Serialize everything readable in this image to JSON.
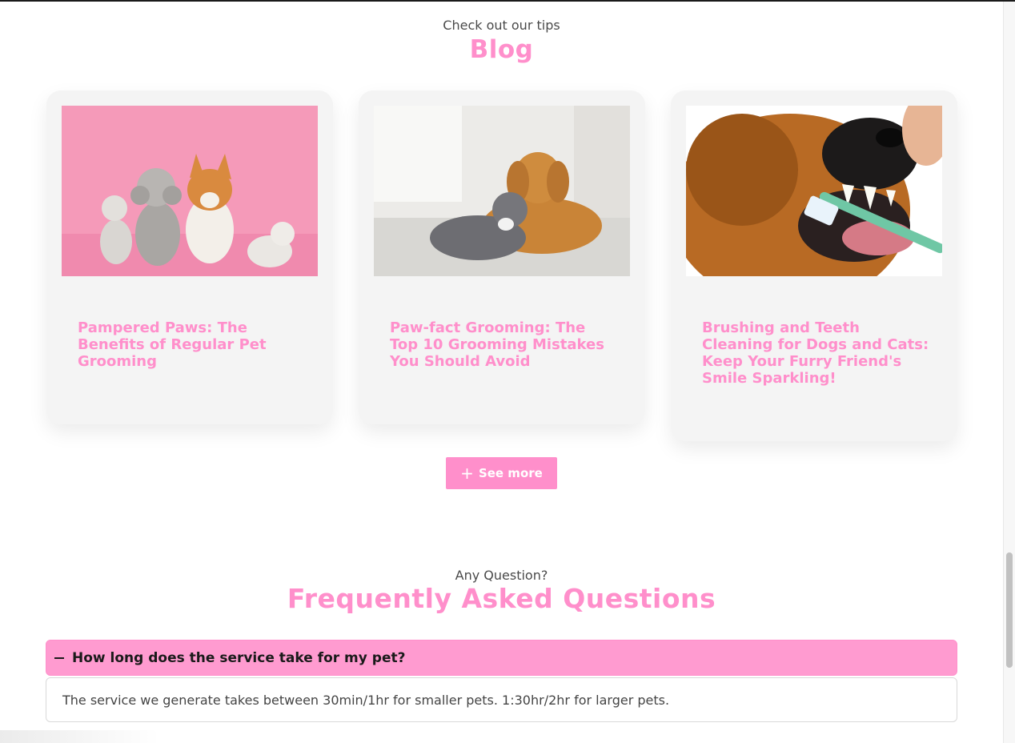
{
  "blog": {
    "eyebrow": "Check out our tips",
    "title": "Blog",
    "posts": [
      {
        "title": "Pampered Paws: The Benefits of Regular Pet Grooming"
      },
      {
        "title": "Paw-fact Grooming: The Top 10 Grooming Mistakes You Should Avoid"
      },
      {
        "title": "Brushing and Teeth Cleaning for Dogs and Cats: Keep Your Furry Friend's Smile Sparkling!"
      }
    ],
    "see_more": "See more",
    "see_more_icon": "plus-icon"
  },
  "faq": {
    "eyebrow": "Any Question?",
    "title": "Frequently Asked Questions",
    "items": [
      {
        "question": "How long does the service take for my pet?",
        "answer": "The service we generate takes between 30min/1hr for smaller pets. 1:30hr/2hr for larger pets.",
        "expanded": true
      }
    ]
  },
  "colors": {
    "accent": "#ff8fcb",
    "card_bg": "#f4f4f4",
    "faq_header_bg": "#ff9bd0"
  }
}
